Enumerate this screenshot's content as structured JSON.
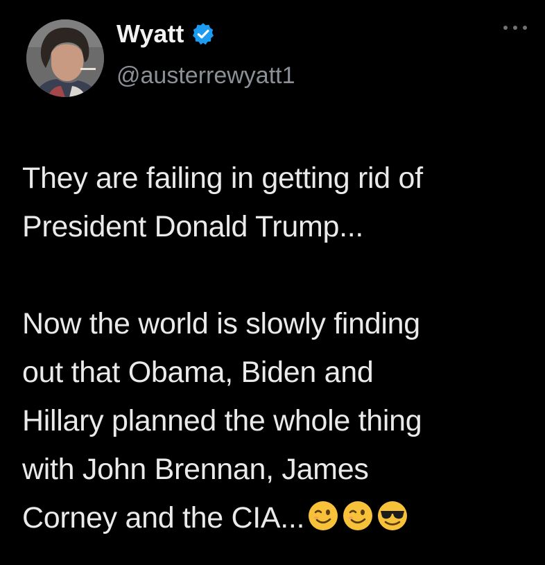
{
  "user": {
    "display_name": "Wyatt",
    "handle": "@austerrewyatt1",
    "verified": true,
    "avatar_icon": "profile-photo",
    "verified_icon": "verified-badge-icon"
  },
  "menu": {
    "icon": "more-options-icon"
  },
  "tweet": {
    "lines_p1": [
      "They are failing in getting rid of",
      "President Donald Trump..."
    ],
    "lines_p2": [
      "Now the world is slowly finding",
      "out that Obama, Biden and",
      "Hillary planned the whole thing",
      "with John Brennan, James",
      "Corney and the CIA..."
    ],
    "emojis": [
      "winking-face-icon",
      "winking-face-icon",
      "smiling-face-with-sunglasses-icon"
    ]
  },
  "colors": {
    "background": "#000000",
    "text": "#eaeaea",
    "handle": "#8b9096",
    "verified": "#1d9bf0"
  }
}
